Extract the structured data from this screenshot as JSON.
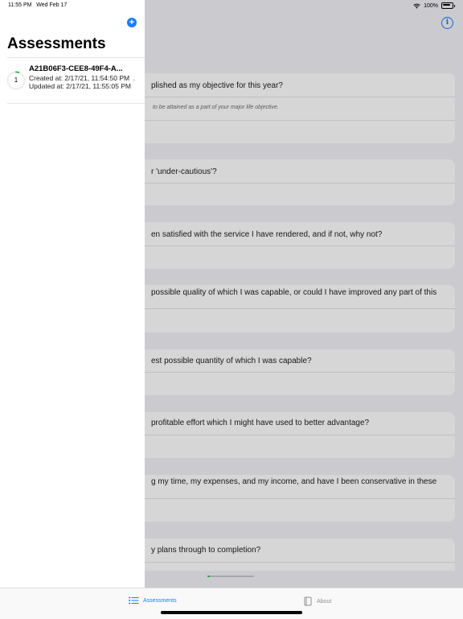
{
  "status_bar": {
    "time": "11:55 PM",
    "date": "Wed Feb 17",
    "battery": "100%"
  },
  "sidebar": {
    "title": "Assessments",
    "items": [
      {
        "badge": "1",
        "title": "A21B06F3-CEE8-49F4-A...",
        "created": "Created at: 2/17/21, 11:54:50 PM",
        "updated": "Updated at: 2/17/21, 11:55:05 PM",
        "progress": 0.05
      }
    ]
  },
  "main": {
    "questions": [
      {
        "text": "plished as my objective for this year?",
        "hint": "to be attained as a part of your major life objective."
      },
      {
        "text": "r 'under-cautious'?"
      },
      {
        "text": "en satisfied with the service I have rendered, and if not, why not?"
      },
      {
        "text": "possible quality of which I was capable, or could I have improved any part of this"
      },
      {
        "text": "est possible quantity of which I was capable?"
      },
      {
        "text": "profitable effort which I might have used to better advantage?"
      },
      {
        "text": "g my time, my expenses, and my income, and have I been conservative in these"
      },
      {
        "text": "y plans through to completion?"
      }
    ],
    "progress": 0.05
  },
  "tabs": [
    {
      "label": "Assessments",
      "active": true
    },
    {
      "label": "About",
      "active": false
    }
  ],
  "colors": {
    "accent": "#147efb",
    "progress": "#2dbd5a"
  }
}
